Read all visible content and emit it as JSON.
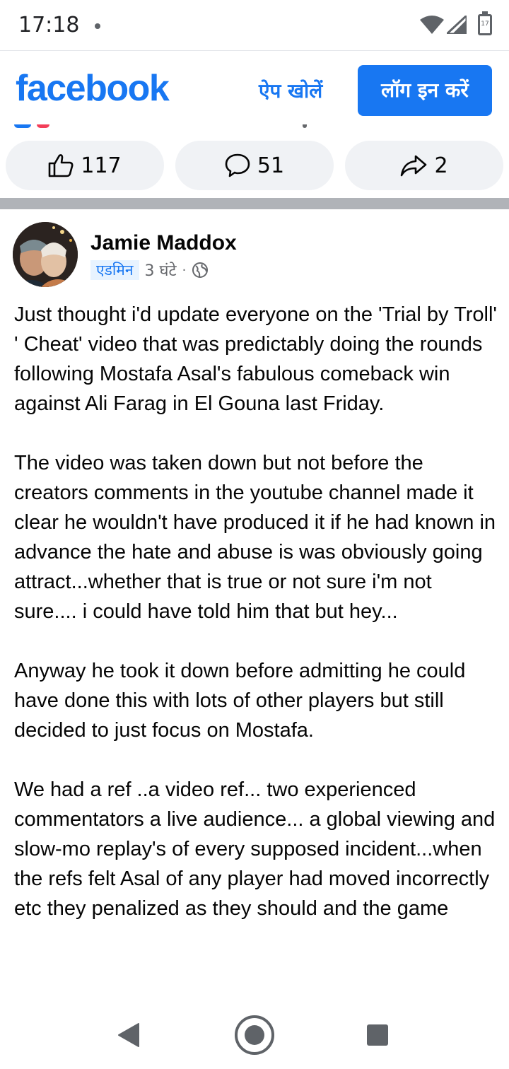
{
  "status_bar": {
    "time": "17:18",
    "battery_label": "17"
  },
  "header": {
    "logo": "facebook",
    "open_app": "ऐप खोलें",
    "login": "लॉग इन करें",
    "brand_color": "#1877f2"
  },
  "actions": {
    "likes": "117",
    "comments": "51",
    "shares": "2"
  },
  "post": {
    "author": "Jamie Maddox",
    "role_badge": "एडमिन",
    "time": "3 घंटे",
    "separator": "·",
    "privacy_icon": "globe-icon",
    "paragraphs": [
      "Just thought i'd update everyone on the 'Trial by Troll' ' Cheat' video  that was predictably doing the rounds following Mostafa Asal's fabulous comeback win against Ali Farag in El Gouna last Friday.",
      "The video was taken down but not before the creators  comments in the youtube channel made it clear he wouldn't have produced it if he had known in advance the hate and abuse is was obviously going attract...whether  that is true or not sure i'm not sure.... i could have told him that but hey...",
      "Anyway he took it down before admitting he could have done this with lots of other players but still decided to just focus on Mostafa.",
      "We had a ref ..a video ref... two experienced commentators a live audience... a global viewing and slow-mo replay's of every supposed incident...when the refs felt Asal of any player had moved incorrectly etc they penalized as they should and the game"
    ]
  },
  "nav": {
    "back_icon": "back-triangle-icon",
    "home_icon": "home-circle-icon",
    "recents_icon": "recents-square-icon"
  }
}
